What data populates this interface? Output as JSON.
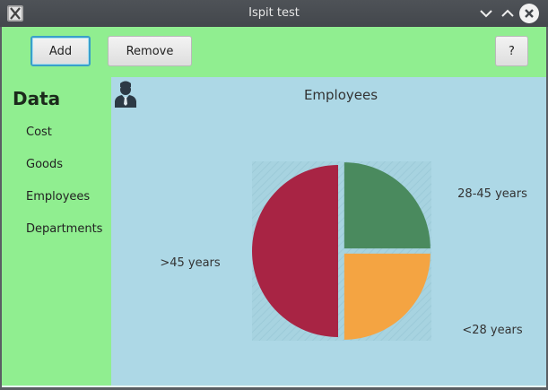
{
  "window": {
    "title": "Ispit test",
    "icon": "app-x-icon",
    "controls": [
      "minimize-icon",
      "maximize-icon",
      "close-icon"
    ]
  },
  "toolbar": {
    "add_label": "Add",
    "remove_label": "Remove",
    "help_label": "?"
  },
  "sidebar": {
    "title": "Data",
    "items": [
      {
        "label": "Cost"
      },
      {
        "label": "Goods"
      },
      {
        "label": "Employees"
      },
      {
        "label": "Departments"
      }
    ]
  },
  "colors": {
    "sidebar_bg": "#90ee90",
    "content_bg": "#add8e6",
    "focus_border": "#3a9fc9"
  },
  "chart_data": {
    "type": "pie",
    "title": "Employees",
    "slices": [
      {
        "label": "28-45 years",
        "value": 25,
        "color": "#4a8a5e"
      },
      {
        "label": "<28 years",
        "value": 25,
        "color": "#f4a442"
      },
      {
        "label": ">45 years",
        "value": 50,
        "color": "#a82444"
      }
    ],
    "legend": "none",
    "start_angle_deg": 90,
    "direction": "clockwise",
    "exploded": true
  }
}
